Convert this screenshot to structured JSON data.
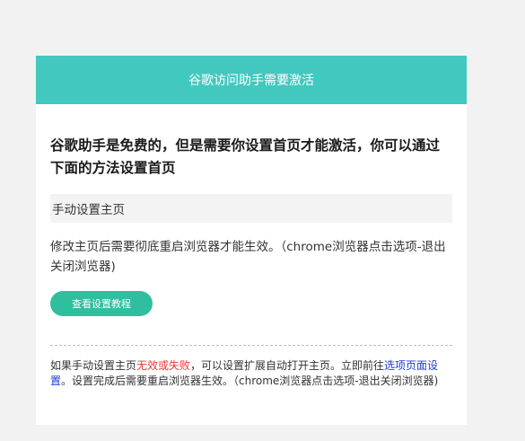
{
  "dialog": {
    "title": "谷歌访问助手需要激活",
    "headline": "谷歌助手是免费的，但是需要你设置首页才能激活，你可以通过下面的方法设置首页",
    "section_title": "手动设置主页",
    "instruction": "修改主页后需要彻底重启浏览器才能生效。（chrome浏览器点击选项-退出关闭浏览器)",
    "tutorial_button": "查看设置教程",
    "footnote": {
      "part1": "如果手动设置主页",
      "warning": "无效或失败",
      "part2": "，可以设置扩展自动打开主页。立即前往",
      "link": "选项页面设置",
      "part3": "。设置完成后需要重启浏览器生效。（chrome浏览器点击选项-退出关闭浏览器)"
    }
  },
  "colors": {
    "header": "#43c8bf",
    "button": "#2fbf9f",
    "warning": "#e53935",
    "link": "#1e3bd6"
  }
}
